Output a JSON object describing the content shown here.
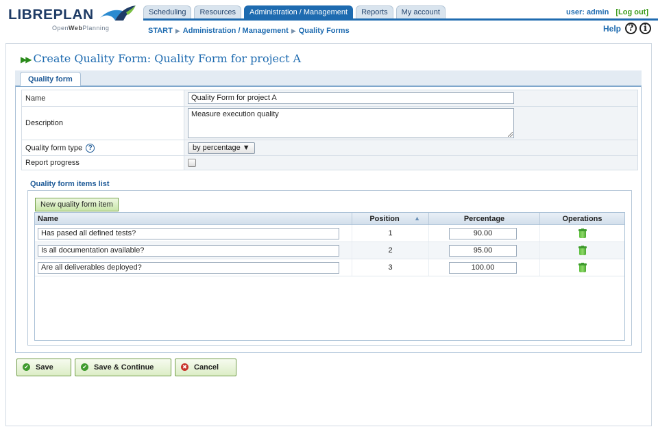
{
  "brand": {
    "name": "LIBREPLAN",
    "sub_prefix": "Open",
    "sub_bold": "Web",
    "sub_suffix": "Planning"
  },
  "tabs": [
    "Scheduling",
    "Resources",
    "Administration / Management",
    "Reports",
    "My account"
  ],
  "active_tab": "Administration / Management",
  "user": {
    "label": "user: admin",
    "logout": "[Log out]"
  },
  "breadcrumb": [
    "START",
    "Administration / Management",
    "Quality Forms"
  ],
  "help": {
    "label": "Help",
    "help_glyph": "?",
    "info_glyph": "i"
  },
  "page_title": "Create Quality Form: Quality Form for project A",
  "form_tab": "Quality form",
  "form": {
    "name_label": "Name",
    "name_value": "Quality Form for project A",
    "description_label": "Description",
    "description_value": "Measure execution quality",
    "type_label": "Quality form type",
    "type_value": "by percentage",
    "report_label": "Report progress",
    "report_checked": false
  },
  "items": {
    "title": "Quality form items list",
    "new_button": "New quality form item",
    "columns": [
      "Name",
      "Position",
      "Percentage",
      "Operations"
    ],
    "rows": [
      {
        "name": "Has pased all defined tests?",
        "position": "1",
        "percentage": "90.00"
      },
      {
        "name": "Is all documentation available?",
        "position": "2",
        "percentage": "95.00"
      },
      {
        "name": "Are all deliverables deployed?",
        "position": "3",
        "percentage": "100.00"
      }
    ]
  },
  "buttons": {
    "save": "Save",
    "save_continue": "Save & Continue",
    "cancel": "Cancel"
  },
  "colors": {
    "accent": "#1e6bb0",
    "ok": "#3f9b2e",
    "danger": "#c8322a"
  },
  "icons": [
    "logo-bird-icon",
    "help-icon",
    "info-icon",
    "question-icon",
    "sort-icon",
    "trash-icon",
    "check-icon",
    "cancel-icon"
  ]
}
